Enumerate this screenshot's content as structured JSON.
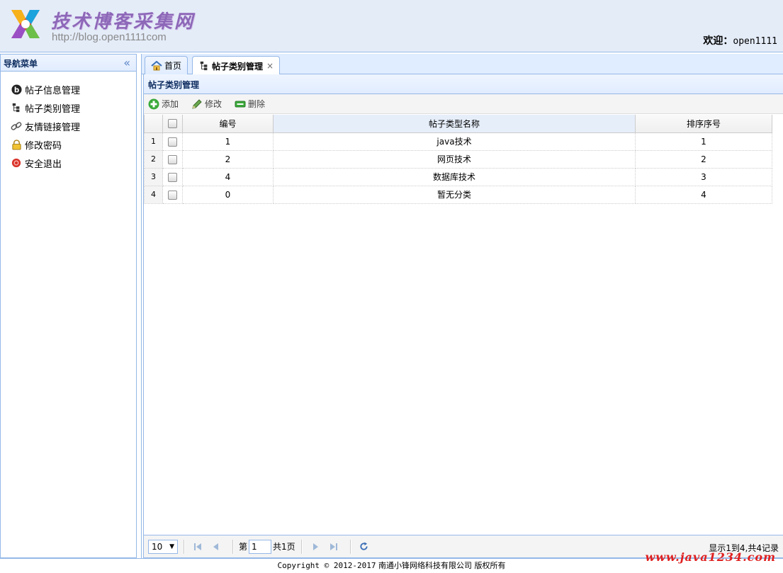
{
  "header": {
    "site_title": "技术博客采集网",
    "site_url": "http://blog.open1111com",
    "welcome_label": "欢迎：",
    "username": "open1111"
  },
  "nav": {
    "title": "导航菜单",
    "collapse_glyph": "«",
    "items": [
      {
        "label": "帖子信息管理",
        "icon": "blog-icon"
      },
      {
        "label": "帖子类别管理",
        "icon": "tree-icon"
      },
      {
        "label": "友情链接管理",
        "icon": "link-icon"
      },
      {
        "label": "修改密码",
        "icon": "lock-icon"
      },
      {
        "label": "安全退出",
        "icon": "exit-icon"
      }
    ]
  },
  "tabs": [
    {
      "label": "首页",
      "icon": "home-icon"
    },
    {
      "label": "帖子类别管理",
      "icon": "tree-icon",
      "close": "×"
    }
  ],
  "panel": {
    "title": "帖子类别管理"
  },
  "toolbar": {
    "add_label": "添加",
    "edit_label": "修改",
    "delete_label": "删除"
  },
  "grid": {
    "columns": [
      "编号",
      "帖子类型名称",
      "排序序号"
    ],
    "rows": [
      {
        "rownum": "1",
        "id": "1",
        "name": "java技术",
        "order": "1"
      },
      {
        "rownum": "2",
        "id": "2",
        "name": "网页技术",
        "order": "2"
      },
      {
        "rownum": "3",
        "id": "4",
        "name": "数据库技术",
        "order": "3"
      },
      {
        "rownum": "4",
        "id": "0",
        "name": "暂无分类",
        "order": "4"
      }
    ]
  },
  "pager": {
    "page_size": "10",
    "page_prefix": "第",
    "page_value": "1",
    "page_total": "共1页",
    "info": "显示1到4,共4记录"
  },
  "footer": {
    "copyright": "Copyright © 2012-2017",
    "company": "南通小锋网络科技有限公司 版权所有"
  },
  "watermark": "www.java1234.com",
  "colors": {
    "border": "#95b8e7",
    "header_bg": "#e4ecf8",
    "title_purple": "#8d67b8"
  }
}
